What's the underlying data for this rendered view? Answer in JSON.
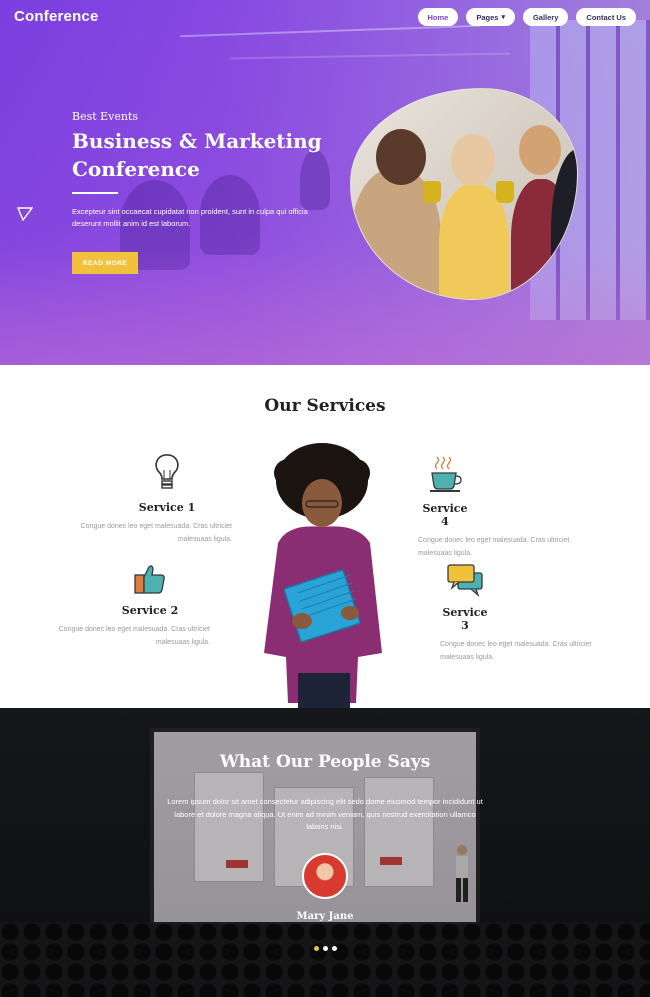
{
  "brand": "Conference",
  "nav": {
    "home": "Home",
    "pages": "Pages",
    "gallery": "Gallery",
    "contact": "Contact Us"
  },
  "hero": {
    "kicker": "Best Events",
    "title": "Business & Marketing Conference",
    "text": "Excepteur sint occaecat cupidatat non proident, sunt in culpa qui officia deserunt mollit anim id est laborum.",
    "button": "READ MORE"
  },
  "services": {
    "title": "Our Services",
    "items": [
      {
        "name": "Service 1",
        "text": "Congue donec leo eget malesuada. Cras ultriciet malesuaas ligula.",
        "icon": "lightbulb-icon"
      },
      {
        "name": "Service 4",
        "text": "Congue donec leo eget malesuada. Cras ultriciet malesuaas ligula.",
        "icon": "coffee-cup-icon"
      },
      {
        "name": "Service 2",
        "text": "Congue donec leo eget malesuada. Cras ultriciet malesuaas ligula.",
        "icon": "thumbs-up-icon"
      },
      {
        "name": "Service 3",
        "text": "Congue donec leo eget malesuada. Cras ultriciet malesuaas ligula.",
        "icon": "chat-bubbles-icon"
      }
    ]
  },
  "testimonial": {
    "title": "What Our People Says",
    "quote": "Lorem ipsum dolor sit amet consectetur adipiscing elit sedo dome eiusmod tempor incididunt ut labore et dolore magna aliqua. Ut enim ad minim veniam, quis nostrud exercitation ullamco laboris nisi.",
    "name": "Mary Jane",
    "slides": 3,
    "active_slide": 1
  },
  "colors": {
    "accent": "#7b3fe0",
    "button": "#f2c13b"
  }
}
